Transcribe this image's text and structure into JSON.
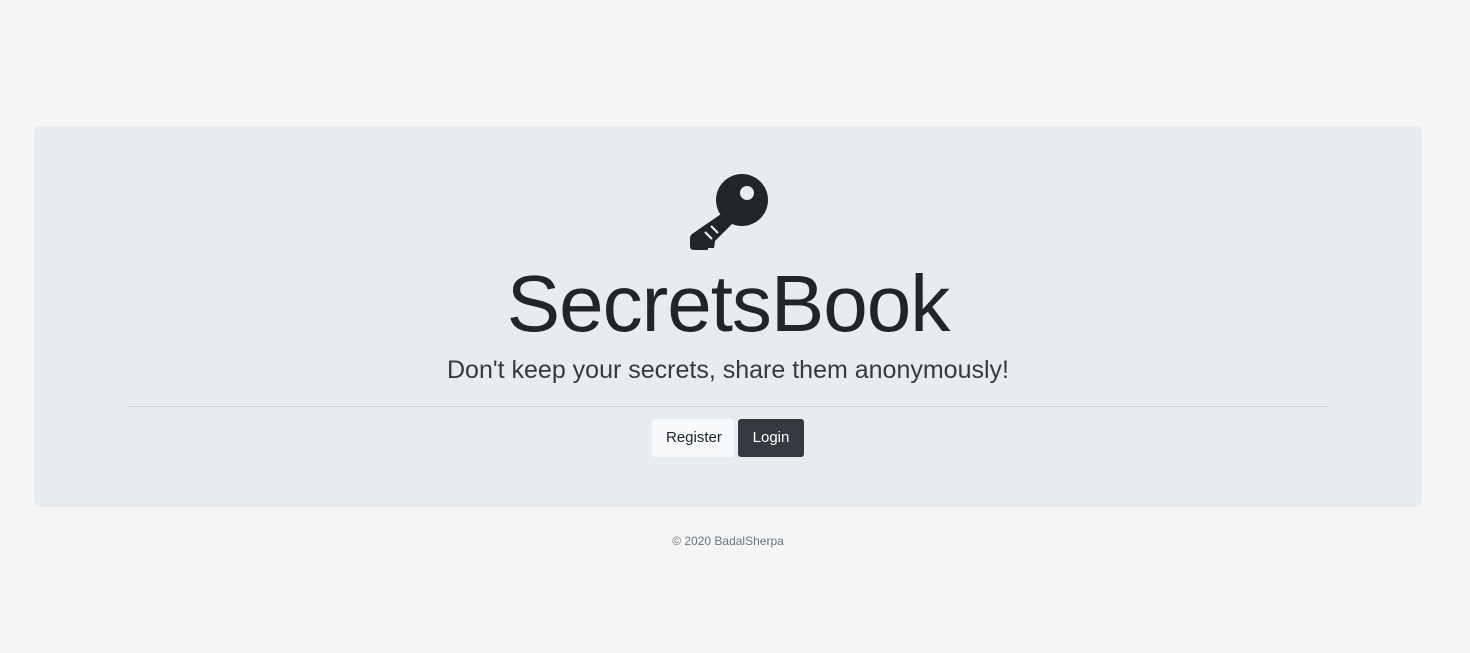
{
  "hero": {
    "icon": "key-icon",
    "title": "SecretsBook",
    "tagline": "Don't keep your secrets, share them anonymously!",
    "register_label": "Register",
    "login_label": "Login"
  },
  "footer": {
    "copyright": "© 2020 BadalSherpa"
  },
  "colors": {
    "page_background": "#f5f5f5",
    "jumbotron_background": "#e9ecef",
    "login_button": "#343a40",
    "register_button": "#f8f9fa"
  }
}
